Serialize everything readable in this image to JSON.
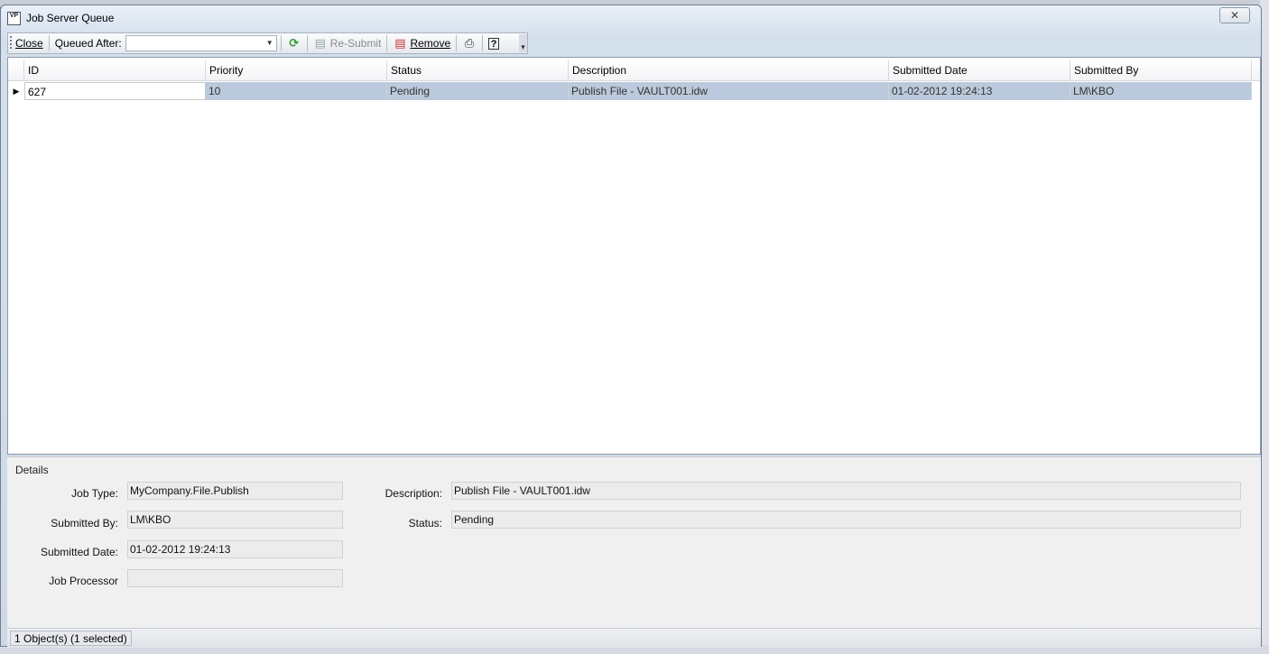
{
  "window": {
    "title": "Job Server Queue",
    "app_icon_text": "VP",
    "close_glyph": "✕"
  },
  "toolbar": {
    "close_label": "Close",
    "queued_after_label": "Queued After:",
    "queued_after_value": "",
    "resubmit_label": "Re-Submit",
    "remove_label": "Remove",
    "icons": [
      "refresh-icon",
      "resubmit-icon",
      "remove-icon",
      "print-icon",
      "help-icon"
    ]
  },
  "grid": {
    "columns": [
      "ID",
      "Priority",
      "Status",
      "Description",
      "Submitted Date",
      "Submitted By"
    ],
    "rows": [
      {
        "id": "627",
        "priority": "10",
        "status": "Pending",
        "description": "Publish File - VAULT001.idw",
        "submitted_date": "01-02-2012 19:24:13",
        "submitted_by": "LM\\KBO"
      }
    ]
  },
  "details": {
    "title": "Details",
    "job_type_label": "Job Type:",
    "job_type_value": "MyCompany.File.Publish",
    "submitted_by_label": "Submitted By:",
    "submitted_by_value": "LM\\KBO",
    "submitted_date_label": "Submitted Date:",
    "submitted_date_value": "01-02-2012 19:24:13",
    "job_processor_label": "Job Processor",
    "job_processor_value": "",
    "description_label": "Description:",
    "description_value": "Publish File - VAULT001.idw",
    "status_label": "Status:",
    "status_value": "Pending"
  },
  "statusbar": {
    "text": "1 Object(s) (1 selected)"
  },
  "colors": {
    "selection": "#bac9db",
    "window_chrome": "#d4dfec",
    "details_bg": "#f0f0f0"
  }
}
